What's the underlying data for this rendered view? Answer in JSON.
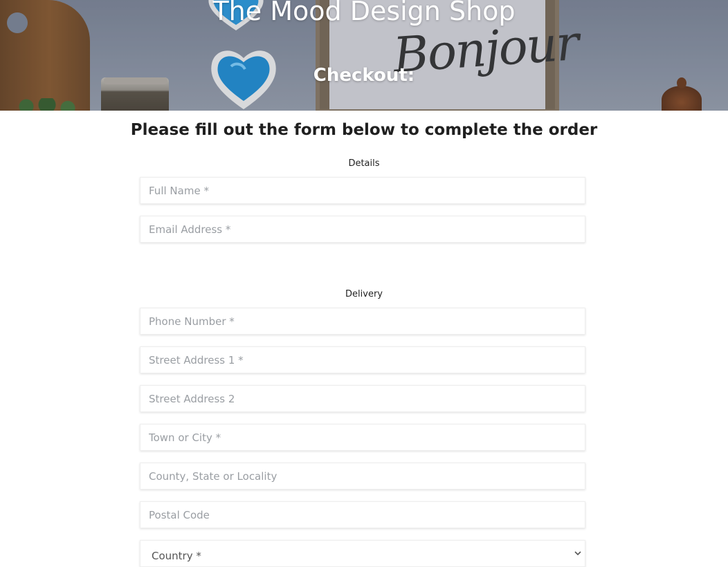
{
  "hero": {
    "title": "The Mood Design Shop",
    "subtitle": "Checkout:",
    "sign_text": "Bonjour"
  },
  "intro": "Please fill out the form below to complete the order",
  "details": {
    "label": "Details",
    "fields": {
      "full_name": "Full Name *",
      "email": "Email Address *"
    }
  },
  "delivery": {
    "label": "Delivery",
    "fields": {
      "phone": "Phone Number *",
      "street1": "Street Address 1 *",
      "street2": "Street Address 2",
      "town": "Town or City *",
      "county": "County, State or Locality",
      "postal": "Postal Code"
    },
    "country_selected": "Country *"
  },
  "colors": {
    "heart": "#2a9be0",
    "text": "#1f1f1f",
    "placeholder": "#9a9ea3"
  }
}
